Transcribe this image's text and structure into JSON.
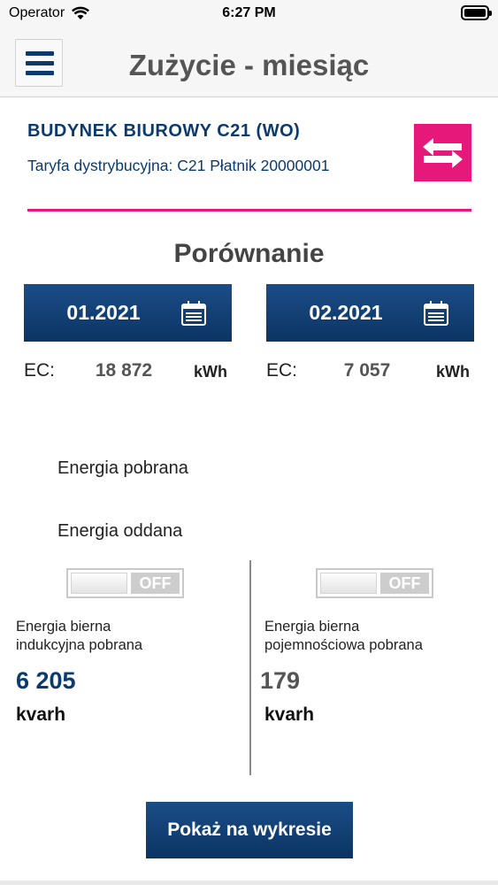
{
  "status_bar": {
    "carrier": "Operator",
    "time": "6:27 PM"
  },
  "header": {
    "title": "Zużycie - miesiąc"
  },
  "building": {
    "name": "BUDYNEK BIUROWY C21 (WO)",
    "tariff": "Taryfa dystrybucyjna: C21 Płatnik 20000001"
  },
  "comparison": {
    "title": "Porównanie",
    "left": {
      "date": "01.2021",
      "ec_label": "EC:",
      "value": "18 872",
      "unit": "kWh"
    },
    "right": {
      "date": "02.2021",
      "ec_label": "EC:",
      "value": "7 057",
      "unit": "kWh"
    }
  },
  "energy": {
    "taken": "Energia pobrana",
    "returned": "Energia oddana"
  },
  "reactive": {
    "left": {
      "toggle_state": "OFF",
      "label_line1": "Energia bierna",
      "label_line2": "indukcyjna pobrana",
      "value": "6 205",
      "unit": "kvarh",
      "value_color": "#0b3a6e"
    },
    "right": {
      "toggle_state": "OFF",
      "label_line1": "Energia bierna",
      "label_line2": "pojemnościowa pobrana",
      "value": "179",
      "unit": "kvarh",
      "value_color": "#555555"
    }
  },
  "actions": {
    "show_chart": "Pokaż na wykresie"
  },
  "colors": {
    "primary": "#0b3a6e",
    "accent": "#e6197b"
  },
  "icons": {
    "menu": "hamburger-menu-icon",
    "switch": "swap-arrows-icon",
    "calendar": "calendar-icon"
  }
}
